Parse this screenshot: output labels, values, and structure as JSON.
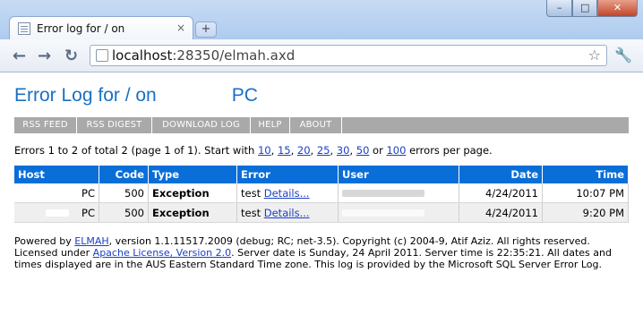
{
  "browser": {
    "tab_title": "Error log for / on ",
    "tab_close": "×",
    "new_tab": "+",
    "window_buttons": {
      "minimize": "–",
      "maximize": "□",
      "close": "✕"
    },
    "url_host": "localhost",
    "url_rest": ":28350/elmah.axd",
    "icons": {
      "back": "arrow-left-icon",
      "forward": "arrow-right-icon",
      "reload": "reload-icon",
      "bookmark": "star-icon",
      "menu": "wrench-icon"
    }
  },
  "page": {
    "title_prefix": "Error Log for / on",
    "title_host": "PC",
    "speedbar": [
      "RSS FEED",
      "RSS DIGEST",
      "DOWNLOAD LOG",
      "HELP",
      "ABOUT"
    ],
    "stats": {
      "prefix": "Errors 1 to 2 of total 2 (page 1 of 1). Start with",
      "page_sizes": [
        "10",
        "15",
        "20",
        "25",
        "30",
        "50"
      ],
      "or_text": "or",
      "last_size": "100",
      "suffix": "errors per page."
    },
    "table": {
      "columns": [
        "Host",
        "Code",
        "Type",
        "Error",
        "User",
        "Date",
        "Time"
      ],
      "rows": [
        {
          "host": "PC",
          "code": "500",
          "type": "Exception",
          "error": "test",
          "details": "Details...",
          "user": "",
          "date": "4/24/2011",
          "time": "10:07 PM"
        },
        {
          "host": "PC",
          "code": "500",
          "type": "Exception",
          "error": "test",
          "details": "Details...",
          "user": "",
          "date": "4/24/2011",
          "time": "9:20 PM"
        }
      ]
    },
    "footer": {
      "line1_prefix": "Powered by",
      "elmah_link": "ELMAH",
      "line1_rest": ", version 1.1.11517.2009 (debug; RC; net-3.5). Copyright (c) 2004-9, Atif Aziz. All rights reserved.",
      "licensed": "Licensed under",
      "license_link": "Apache License, Version 2.0",
      "line2_rest": ". Server date is Sunday, 24 April 2011. Server time is 22:35:21. All dates and times displayed are in the AUS Eastern Standard Time zone. This log is provided by the Microsoft SQL Server Error Log."
    }
  },
  "colors": {
    "title_blue": "#1b6fc4",
    "header_blue": "#0a6ed8",
    "speedbar_gray": "#a9a9a9",
    "link_blue": "#1a3fc7"
  }
}
